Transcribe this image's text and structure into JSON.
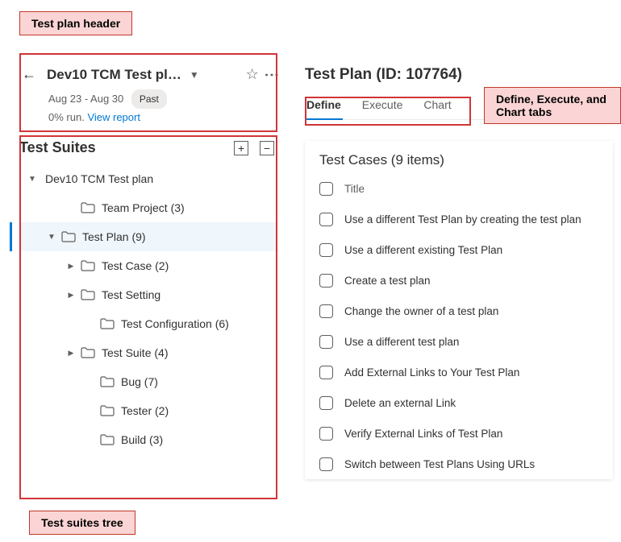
{
  "callouts": {
    "header": "Test plan header",
    "tabs": "Define, Execute, and Chart tabs",
    "tree": "Test suites tree"
  },
  "header": {
    "title": "Dev10 TCM Test pl…",
    "date_range": "Aug 23 - Aug 30",
    "badge": "Past",
    "run_status": "0% run.",
    "report_link": "View report"
  },
  "suites": {
    "title": "Test Suites",
    "rows": [
      {
        "indent": 0,
        "expander": "down",
        "icon": false,
        "label": "Dev10 TCM Test plan",
        "selected": false
      },
      {
        "indent": 2,
        "expander": "",
        "icon": true,
        "label": "Team Project (3)",
        "selected": false
      },
      {
        "indent": 1,
        "expander": "down",
        "icon": true,
        "label": "Test Plan (9)",
        "selected": true
      },
      {
        "indent": 2,
        "expander": "right",
        "icon": true,
        "label": "Test Case (2)",
        "selected": false
      },
      {
        "indent": 2,
        "expander": "right",
        "icon": true,
        "label": "Test Setting",
        "selected": false
      },
      {
        "indent": 3,
        "expander": "",
        "icon": true,
        "label": "Test Configuration (6)",
        "selected": false
      },
      {
        "indent": 2,
        "expander": "right",
        "icon": true,
        "label": "Test Suite (4)",
        "selected": false
      },
      {
        "indent": 3,
        "expander": "",
        "icon": true,
        "label": "Bug (7)",
        "selected": false
      },
      {
        "indent": 3,
        "expander": "",
        "icon": true,
        "label": "Tester (2)",
        "selected": false
      },
      {
        "indent": 3,
        "expander": "",
        "icon": true,
        "label": "Build (3)",
        "selected": false
      }
    ]
  },
  "right": {
    "title": "Test Plan (ID: 107764)",
    "tabs": [
      "Define",
      "Execute",
      "Chart"
    ],
    "active_tab": 0,
    "cases_title": "Test Cases (9 items)",
    "column_header": "Title",
    "cases": [
      "Use a different Test Plan by creating the test plan",
      "Use a different existing Test Plan",
      "Create a test plan",
      "Change the owner of a test plan",
      "Use a different test plan",
      "Add External Links to Your Test Plan",
      "Delete an external Link",
      "Verify External Links of Test Plan",
      "Switch between Test Plans Using URLs"
    ]
  }
}
